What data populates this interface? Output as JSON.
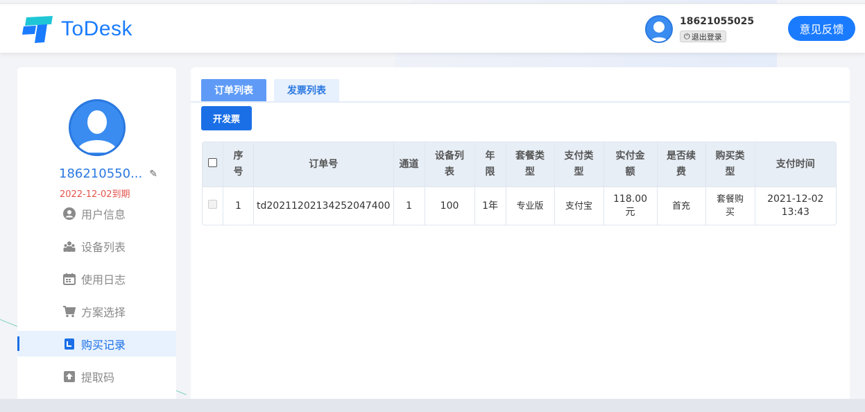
{
  "header": {
    "brand": "ToDesk",
    "phone": "18621055025",
    "logout_label": "退出登录",
    "feedback_label": "意见反馈"
  },
  "sidebar": {
    "username": "186210550...",
    "expire": "2022-12-02到期",
    "items": [
      {
        "label": "用户信息",
        "icon": "user-circle-icon"
      },
      {
        "label": "设备列表",
        "icon": "group-icon"
      },
      {
        "label": "使用日志",
        "icon": "calendar-icon"
      },
      {
        "label": "方案选择",
        "icon": "cart-icon"
      },
      {
        "label": "购买记录",
        "icon": "receipt-icon",
        "active": true
      },
      {
        "label": "提取码",
        "icon": "inbox-icon"
      }
    ]
  },
  "main": {
    "tabs": [
      {
        "label": "订单列表",
        "active": true
      },
      {
        "label": "发票列表",
        "active": false
      }
    ],
    "invoice_button": "开发票",
    "table": {
      "headers": [
        "序号",
        "订单号",
        "通道",
        "设备列表",
        "年限",
        "套餐类型",
        "支付类型",
        "实付金额",
        "是否续费",
        "购买类型",
        "支付时间"
      ],
      "rows": [
        {
          "index": "1",
          "order_no": "td20211202134252047400",
          "channel": "1",
          "devices": "100",
          "years": "1年",
          "plan": "专业版",
          "pay_type": "支付宝",
          "amount": "118.00元",
          "renew": "首充",
          "buy_type": "套餐购买",
          "pay_time": "2021-12-02 13:43"
        }
      ]
    }
  }
}
